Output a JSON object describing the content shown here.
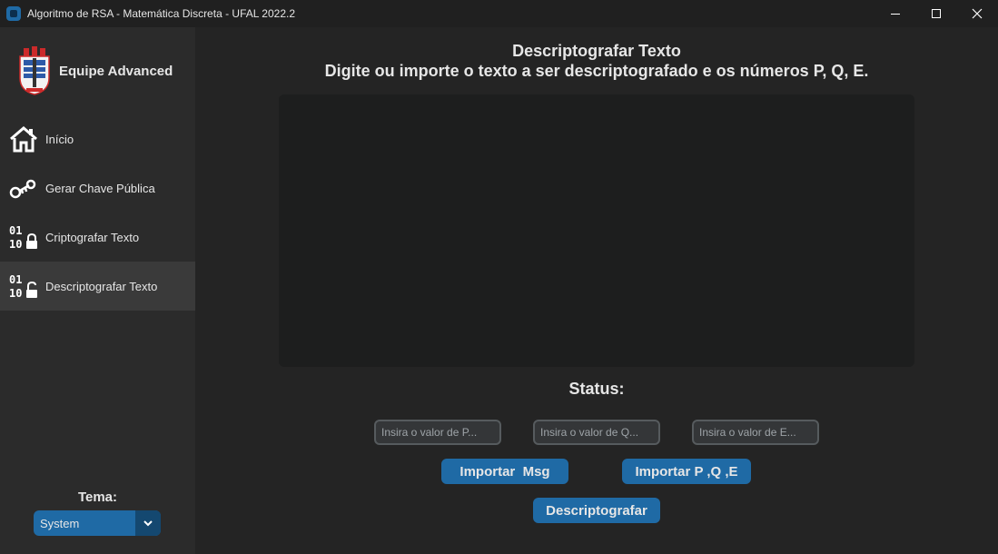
{
  "window": {
    "title": "Algoritmo de RSA - Matemática Discreta -  UFAL 2022.2"
  },
  "sidebar": {
    "team_name": "Equipe Advanced",
    "items": [
      {
        "label": "Início",
        "icon": "home-icon",
        "active": false
      },
      {
        "label": "Gerar Chave Pública",
        "icon": "key-icon",
        "active": false
      },
      {
        "label": "Criptografar Texto",
        "icon": "binary-lock-icon",
        "active": false
      },
      {
        "label": "Descriptografar Texto",
        "icon": "binary-unlock-icon",
        "active": true
      }
    ],
    "theme_label": "Tema:",
    "theme_value": "System"
  },
  "main": {
    "title": "Descriptografar Texto",
    "subtitle": "Digite ou importe o texto a ser descriptografado e os números P, Q, E.",
    "text_value": "",
    "status_label": "Status:",
    "inputs": {
      "p_placeholder": "Insira o valor de P...",
      "q_placeholder": "Insira o valor de Q...",
      "e_placeholder": "Insira o valor de E..."
    },
    "buttons": {
      "import_msg": "Importar  Msg",
      "import_pqe": "Importar P ,Q ,E",
      "decrypt": "Descriptografar"
    }
  },
  "colors": {
    "accent": "#1f6aa5",
    "sidebar_bg": "#2b2b2b",
    "main_bg": "#242424",
    "active_item": "#3a3a3a"
  }
}
